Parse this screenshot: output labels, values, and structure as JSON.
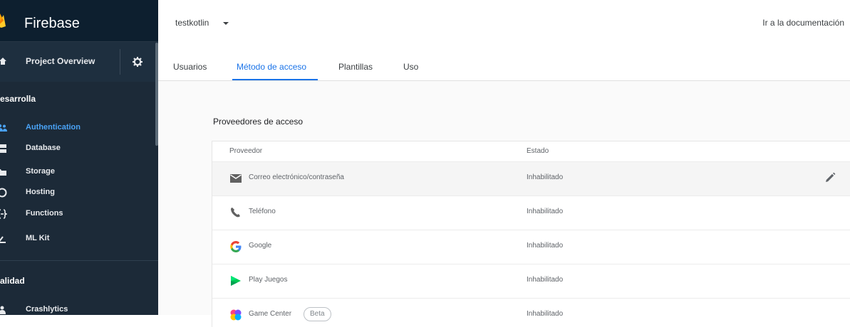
{
  "sidebar": {
    "brand": "Firebase",
    "overview_label": "Project Overview",
    "sections": [
      {
        "title": "esarrolla",
        "items": [
          {
            "label": "Authentication",
            "icon": "people-icon",
            "active": true
          },
          {
            "label": "Database",
            "icon": "database-icon"
          },
          {
            "label": "Storage",
            "icon": "storage-icon"
          },
          {
            "label": "Hosting",
            "icon": "hosting-icon"
          },
          {
            "label": "Functions",
            "icon": "functions-icon"
          },
          {
            "label": "ML Kit",
            "icon": "ml-kit-icon"
          }
        ]
      },
      {
        "title": "alidad",
        "items": [
          {
            "label": "Crashlytics",
            "icon": "crashlytics-icon"
          }
        ]
      }
    ]
  },
  "header": {
    "project": "testkotlin",
    "doc_link": "Ir a la documentación"
  },
  "tabs": [
    {
      "label": "Usuarios"
    },
    {
      "label": "Método de acceso",
      "active": true
    },
    {
      "label": "Plantillas"
    },
    {
      "label": "Uso"
    }
  ],
  "main": {
    "title": "Proveedores de acceso",
    "columns": {
      "provider": "Proveedor",
      "state": "Estado"
    },
    "providers": [
      {
        "name": "Correo electrónico/contraseña",
        "state": "Inhabilitado",
        "icon": "mail-icon"
      },
      {
        "name": "Teléfono",
        "state": "Inhabilitado",
        "icon": "phone-icon"
      },
      {
        "name": "Google",
        "state": "Inhabilitado",
        "icon": "google-icon"
      },
      {
        "name": "Play Juegos",
        "state": "Inhabilitado",
        "icon": "play-games-icon"
      },
      {
        "name": "Game Center",
        "badge": "Beta",
        "state": "Inhabilitado",
        "icon": "game-center-icon"
      }
    ]
  },
  "colors": {
    "sidebar_bg": "#1c2a38",
    "accent": "#1a73e8",
    "sidebar_active": "#4aa3f7"
  }
}
